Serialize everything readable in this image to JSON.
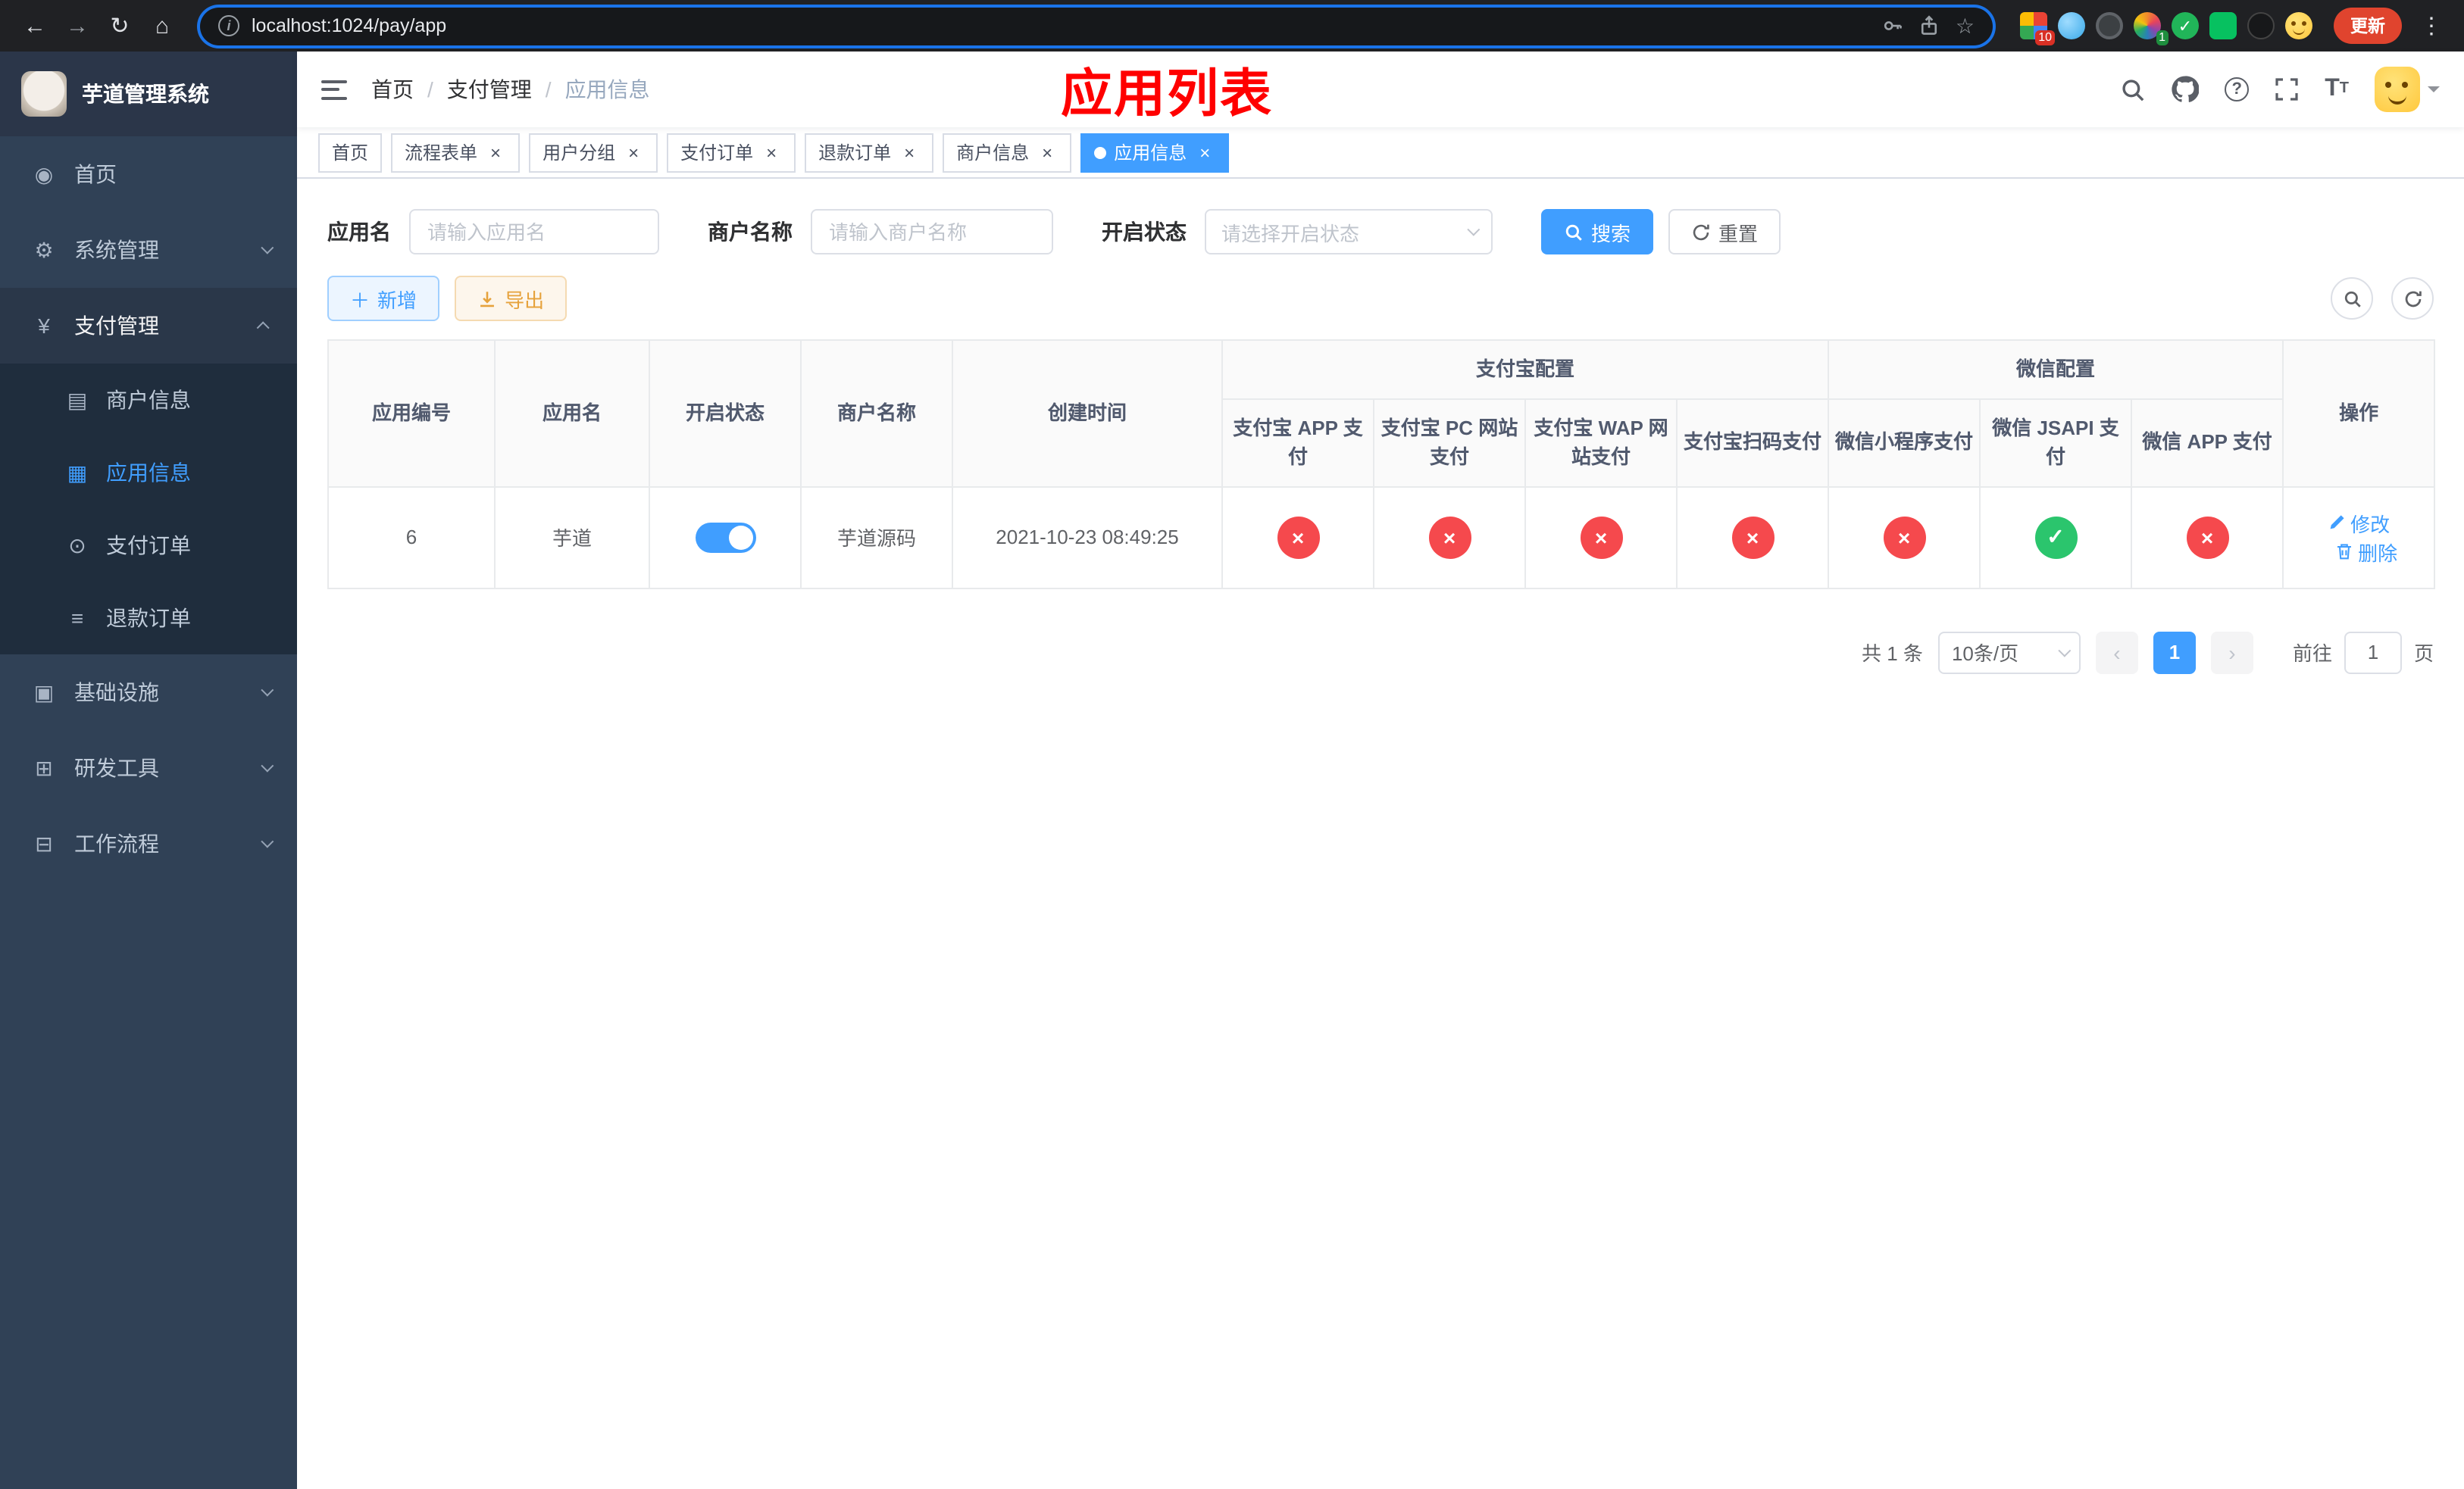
{
  "colors": {
    "accent": "#409eff",
    "success": "#2bc56d",
    "danger": "#f5494d",
    "warning": "#e6a23c",
    "sidebar_bg": "#304156",
    "submenu_bg": "#1f2d3d",
    "annotation_red": "#ff0000",
    "tab_active_bg": "#409eff"
  },
  "browser": {
    "url": "localhost:1024/pay/app",
    "update_button": "更新",
    "ext_badge_grid": "10",
    "ext_badge_circle": "1"
  },
  "sidebar": {
    "app_title": "芋道管理系统",
    "items": [
      {
        "label": "首页"
      },
      {
        "label": "系统管理"
      },
      {
        "label": "支付管理",
        "children": [
          {
            "label": "商户信息"
          },
          {
            "label": "应用信息"
          },
          {
            "label": "支付订单"
          },
          {
            "label": "退款订单"
          }
        ]
      },
      {
        "label": "基础设施"
      },
      {
        "label": "研发工具"
      },
      {
        "label": "工作流程"
      }
    ]
  },
  "header": {
    "breadcrumb": [
      "首页",
      "支付管理",
      "应用信息"
    ],
    "annotation": "应用列表"
  },
  "tabs": [
    {
      "label": "首页",
      "closable": false,
      "active": false
    },
    {
      "label": "流程表单",
      "closable": true,
      "active": false
    },
    {
      "label": "用户分组",
      "closable": true,
      "active": false
    },
    {
      "label": "支付订单",
      "closable": true,
      "active": false
    },
    {
      "label": "退款订单",
      "closable": true,
      "active": false
    },
    {
      "label": "商户信息",
      "closable": true,
      "active": false
    },
    {
      "label": "应用信息",
      "closable": true,
      "active": true
    }
  ],
  "filters": {
    "app_name_label": "应用名",
    "app_name_placeholder": "请输入应用名",
    "merchant_label": "商户名称",
    "merchant_placeholder": "请输入商户名称",
    "status_label": "开启状态",
    "status_placeholder": "请选择开启状态",
    "search_button": "搜索",
    "reset_button": "重置"
  },
  "toolbar": {
    "add_button": "新增",
    "export_button": "导出"
  },
  "table": {
    "base_columns": [
      "应用编号",
      "应用名",
      "开启状态",
      "商户名称",
      "创建时间"
    ],
    "alipay_group": "支付宝配置",
    "alipay_columns": [
      "支付宝 APP 支付",
      "支付宝 PC 网站支付",
      "支付宝 WAP 网站支付",
      "支付宝扫码支付"
    ],
    "wechat_group": "微信配置",
    "wechat_columns": [
      "微信小程序支付",
      "微信 JSAPI 支付",
      "微信 APP 支付"
    ],
    "ops_column": "操作",
    "rows": [
      {
        "id": "6",
        "name": "芋道",
        "enabled": true,
        "merchant": "芋道源码",
        "created_at": "2021-10-23 08:49:25",
        "statuses": [
          false,
          false,
          false,
          false,
          false,
          true,
          false
        ],
        "edit_label": "修改",
        "delete_label": "删除"
      }
    ]
  },
  "pagination": {
    "total": "共 1 条",
    "page_size": "10条/页",
    "current_page": "1",
    "goto_label": "前往",
    "goto_value": "1",
    "goto_suffix": "页"
  }
}
